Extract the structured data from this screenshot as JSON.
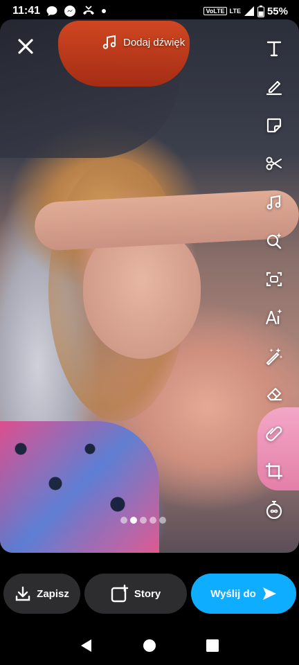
{
  "status_bar": {
    "time": "11:41",
    "network_badge": "VoLTE",
    "lte_label": "LTE",
    "battery": "55%"
  },
  "editor": {
    "close_icon": "close-icon",
    "add_sound_label": "Dodaj dźwięk",
    "tools": [
      {
        "name": "text-tool",
        "icon": "T-icon"
      },
      {
        "name": "draw-tool",
        "icon": "pencil-icon"
      },
      {
        "name": "sticker-tool",
        "icon": "sticker-icon"
      },
      {
        "name": "scissors-tool",
        "icon": "scissors-icon"
      },
      {
        "name": "music-tool",
        "icon": "music-note-icon"
      },
      {
        "name": "lens-search-tool",
        "icon": "sparkle-search-icon"
      },
      {
        "name": "scan-tool",
        "icon": "scan-icon"
      },
      {
        "name": "ai-tool",
        "icon": "ai-text-icon"
      },
      {
        "name": "magic-wand-tool",
        "icon": "magic-wand-icon"
      },
      {
        "name": "eraser-tool",
        "icon": "eraser-icon"
      },
      {
        "name": "link-tool",
        "icon": "paperclip-icon"
      },
      {
        "name": "crop-tool",
        "icon": "crop-icon"
      },
      {
        "name": "timer-tool",
        "icon": "infinity-timer-icon"
      }
    ],
    "page_dots": {
      "count": 5,
      "active_index": 1
    }
  },
  "actions": {
    "save_label": "Zapisz",
    "story_label": "Story",
    "send_label": "Wyślij do"
  },
  "colors": {
    "send_button": "#0fadff",
    "secondary_button": "#2d2d2f"
  }
}
